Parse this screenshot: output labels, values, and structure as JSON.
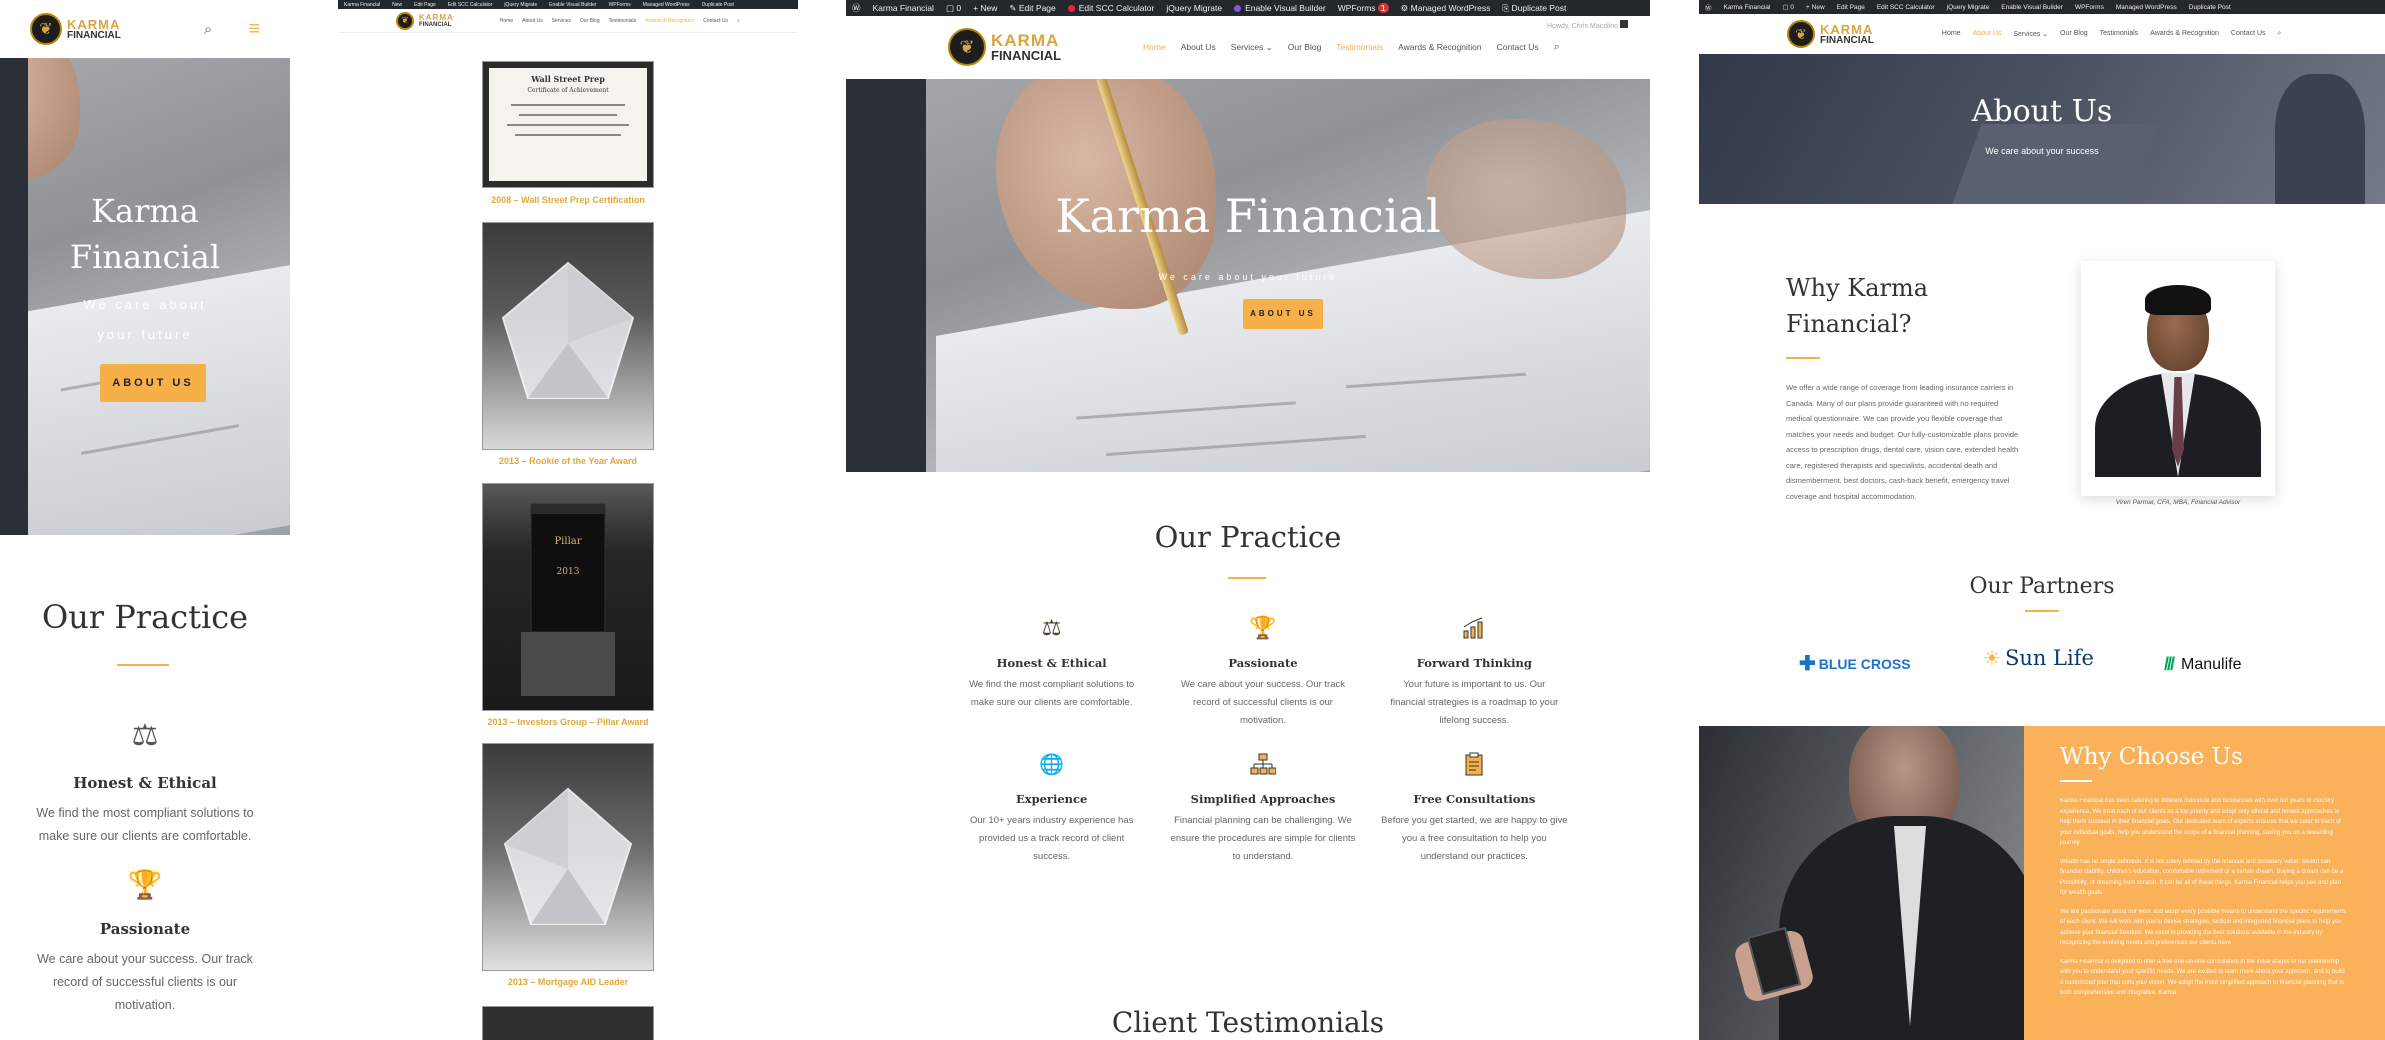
{
  "brand": {
    "karma": "KARMA",
    "financial": "FINANCIAL",
    "accent": "#f5b049"
  },
  "admin_bar": {
    "items": [
      "Karma Financial",
      "New",
      "Edit Page",
      "Edit SCC Calculator",
      "jQuery Migrate",
      "Enable Visual Builder",
      "WPForms",
      "Managed WordPress",
      "Duplicate Post"
    ],
    "wpforms_badge": "1"
  },
  "nav": {
    "items": [
      "Home",
      "About Us",
      "Services",
      "Our Blog",
      "Testimonials",
      "Awards & Recognition",
      "Contact Us"
    ],
    "greeting": "Howdy, Chris Macolino"
  },
  "hero": {
    "title": "Karma Financial",
    "title_line1": "Karma",
    "title_line2": "Financial",
    "subtitle": "We care about your future",
    "subtitle_line1": "We care about",
    "subtitle_line2": "your future",
    "button": "ABOUT US"
  },
  "practice": {
    "title": "Our Practice",
    "features": [
      {
        "icon": "scales-icon",
        "title": "Honest & Ethical",
        "text": "We find the most compliant solutions to make sure our clients are comfortable."
      },
      {
        "icon": "trophy-icon",
        "title": "Passionate",
        "text": "We care about your success. Our track record of successful clients is our motivation."
      },
      {
        "icon": "growth-chart-icon",
        "title": "Forward Thinking",
        "text": "Your future is important to us. Our financial strategies is a roadmap to your lifelong success."
      },
      {
        "icon": "globe-icon",
        "title": "Experience",
        "text": "Our 10+ years industry experience has provided us a track record of client success."
      },
      {
        "icon": "hierarchy-icon",
        "title": "Simplified Approaches",
        "text": "Financial planning can be challenging. We ensure the procedures are simple for clients to understand."
      },
      {
        "icon": "clipboard-icon",
        "title": "Free Consultations",
        "text": "Before you get started, we are happy to give you a free consultation to help you understand our practices."
      }
    ]
  },
  "testimonials": {
    "title": "Client Testimonials"
  },
  "awards": [
    {
      "caption": "2008 – Wall Street Prep Certification",
      "cert_title": "Wall Street Prep",
      "cert_sub": "Certificate of Achievement"
    },
    {
      "caption": "2013 – Rookie of the Year Award"
    },
    {
      "caption": "2013 – Investors Group – Pillar Award"
    },
    {
      "caption": "2013 – Mortgage AID Leader"
    }
  ],
  "about": {
    "title": "About Us",
    "subtitle": "We care about your success",
    "why_title_line1": "Why Karma",
    "why_title_line2": "Financial?",
    "why_text": "We offer a wide range of coverage from leading insurance carriers in Canada. Many of our plans provide guaranteed with no required medical questionnaire. We can provide you flexible coverage that matches your needs and budget. Our fully-customizable plans provide access to prescription drugs, dental care, vision care, extended health care, registered therapists and specialists, accidental death and dismemberment, best doctors, cash-back benefit, emergency travel coverage and hospital accommodation.",
    "photo_caption": "Viren Parmar, CFA, MBA, Financial Advisor",
    "partners_title": "Our Partners",
    "partners": [
      "BLUE CROSS",
      "Sun Life",
      "Manulife"
    ],
    "choose_title": "Why Choose Us",
    "choose_paragraphs": [
      "Karma Financial has been catering to different individual and businesses with over ten years of industry experience. We treat each of our clients as a top priority and adopt only ethical and honest approaches to help them succeed in their financial goals. Our dedicated team of experts ensures that we cater to each of your individual goals, help you understand the scope of a financial planning, saving you on a rewarding journey.",
      "Wealth has no single definition. It is not solely defined by the financial and monetary value; wealth can financial stability, children's education, comfortable retirement or a certain dream. Buying a dream can be a Possibility, or dreaming from scratch. It can be all of these things. Karma Financial helps you see and plan for wealth goals.",
      "We are passionate about our work and adopt every possible means to understand the specific requirements of each client. We will work with you to devise strategies, tactical and integrated financial plans to help you achieve your financial freedom. We excel in providing the best solutions available in the industry by recognizing the evolving needs and preferences our clients have.",
      "Karma Financial is delighted to offer a free one-on-one consultation in the initial stages of our relationship with you to understand your specific needs. We are excited to learn more about your approach, and to build a customized plan that suits your vision. We adopt the most simplified approach to financial planning that is both comprehensive and integrative. Karma"
    ]
  }
}
